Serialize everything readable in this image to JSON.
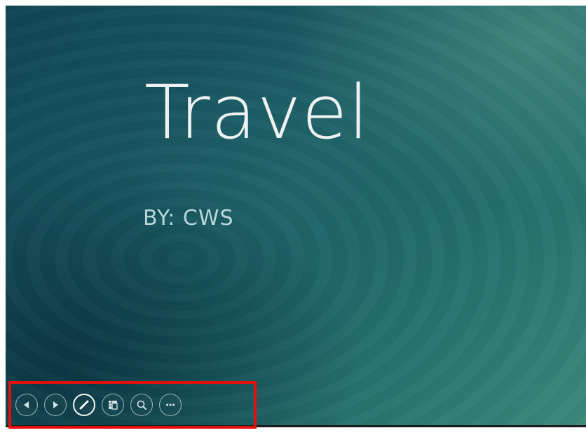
{
  "slide": {
    "title": "Travel",
    "subtitle": "BY: CWS"
  },
  "toolbar": {
    "buttons": [
      {
        "name": "previous-slide",
        "icon": "arrow-left-icon"
      },
      {
        "name": "next-slide",
        "icon": "arrow-right-icon"
      },
      {
        "name": "pen-tool",
        "icon": "pen-icon"
      },
      {
        "name": "see-all-slides",
        "icon": "slides-grid-icon"
      },
      {
        "name": "zoom",
        "icon": "magnifier-icon"
      },
      {
        "name": "more-options",
        "icon": "ellipsis-icon"
      }
    ],
    "highlight_color": "#e01010"
  },
  "colors": {
    "title": "#eef1f1",
    "subtitle": "#b7d7dc",
    "background_dark": "#0f4552",
    "background_light": "#3b8a7c"
  }
}
